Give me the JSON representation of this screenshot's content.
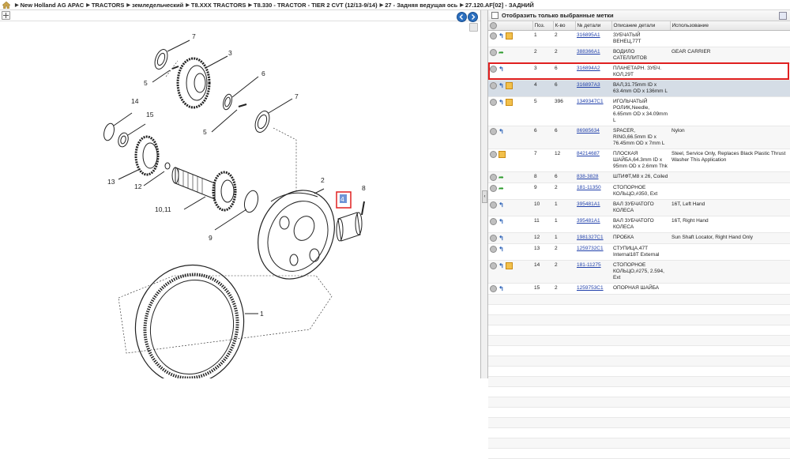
{
  "breadcrumb": [
    "New Holland AG APAC",
    "TRACTORS",
    "земледельческий",
    "T8.XXX TRACTORS",
    "T8.330 - TRACTOR - TIER 2 CVT (12/13-9/14)",
    "27 - Задняя ведущая ось",
    "27.120.AF[02] - ЗАДНИЙ"
  ],
  "panel": {
    "show_selected_label": "Отобразить только выбранные метки"
  },
  "table": {
    "headers": [
      "Поз.",
      "К-во",
      "№ детали",
      "Описание детали",
      "Использование"
    ],
    "rows": [
      {
        "pos": "1",
        "qty": "2",
        "part": "316895A1",
        "desc": "ЗУБЧАТЫЙ ВЕНЕЦ,77T",
        "usage": "",
        "icons": "info-box"
      },
      {
        "pos": "2",
        "qty": "2",
        "part": "388366A1",
        "desc": "ВОДИЛО САТЕЛЛИТОВ",
        "usage": "GEAR CARRIER",
        "icons": "arrow"
      },
      {
        "pos": "3",
        "qty": "6",
        "part": "316894A2",
        "desc": "ПЛАНЕТАРН. ЗУБЧ. КОЛ,29T",
        "usage": "",
        "icons": "info"
      },
      {
        "pos": "4",
        "qty": "6",
        "part": "316897A3",
        "desc": "ВАЛ,31.75mm ID x 63.4mm OD x 136mm L",
        "usage": "",
        "icons": "info-box"
      },
      {
        "pos": "5",
        "qty": "396",
        "part": "1349347C1",
        "desc": "ИГОЛЬЧАТЫЙ РОЛИК,Needle, 6.65mm OD x 34.09mm L",
        "usage": "",
        "icons": "info-box"
      },
      {
        "pos": "6",
        "qty": "6",
        "part": "86985634",
        "desc": "SPACER, RING,66.5mm ID x 76.45mm OD x 7mm L",
        "usage": "Nylon",
        "icons": "info"
      },
      {
        "pos": "7",
        "qty": "12",
        "part": "84214687",
        "desc": "ПЛОСКАЯ ШАЙБА,64.3mm ID x 95mm OD x 2.6mm Thk",
        "usage": "Steel, Service Only, Replaces Black Plastic Thrust Washer This Application",
        "icons": "box"
      },
      {
        "pos": "8",
        "qty": "6",
        "part": "838-3828",
        "desc": "ШТИФТ,M8 x 26, Coiled",
        "usage": "",
        "icons": "arrow"
      },
      {
        "pos": "9",
        "qty": "2",
        "part": "181-11350",
        "desc": "СТОПОРНОЕ КОЛЬЦО,#350, Ext",
        "usage": "",
        "icons": "arrow"
      },
      {
        "pos": "10",
        "qty": "1",
        "part": "395481A1",
        "desc": "ВАЛ ЗУБЧАТОГО КОЛЕСА",
        "usage": "16T, Left Hand",
        "icons": "info"
      },
      {
        "pos": "11",
        "qty": "1",
        "part": "395481A1",
        "desc": "ВАЛ ЗУБЧАТОГО КОЛЕСА",
        "usage": "16T, Right Hand",
        "icons": "info"
      },
      {
        "pos": "12",
        "qty": "1",
        "part": "1981327C1",
        "desc": "ПРОБКА",
        "usage": "Sun Shaft Locator, Right Hand Only",
        "icons": "info"
      },
      {
        "pos": "13",
        "qty": "2",
        "part": "1259732C1",
        "desc": "СТУПИЦА,47T Internal18T External",
        "usage": "",
        "icons": "info"
      },
      {
        "pos": "14",
        "qty": "2",
        "part": "181-11275",
        "desc": "СТОПОРНОЕ КОЛЬЦО,#275, 2.594, Ext",
        "usage": "",
        "icons": "info-box"
      },
      {
        "pos": "15",
        "qty": "2",
        "part": "1259753C1",
        "desc": "ОПОРНАЯ ШАЙБА",
        "usage": "",
        "icons": "info"
      }
    ]
  },
  "diagram": {
    "callouts": [
      "7",
      "3",
      "5",
      "6",
      "7",
      "14",
      "15",
      "5",
      "13",
      "12",
      "2",
      "8",
      "4",
      "10,11",
      "9",
      "1"
    ]
  },
  "colors": {
    "selection": "#d5dde6",
    "highlight_border": "#e02020",
    "link": "#1f3faa",
    "nav_button": "#2b6fbf"
  }
}
